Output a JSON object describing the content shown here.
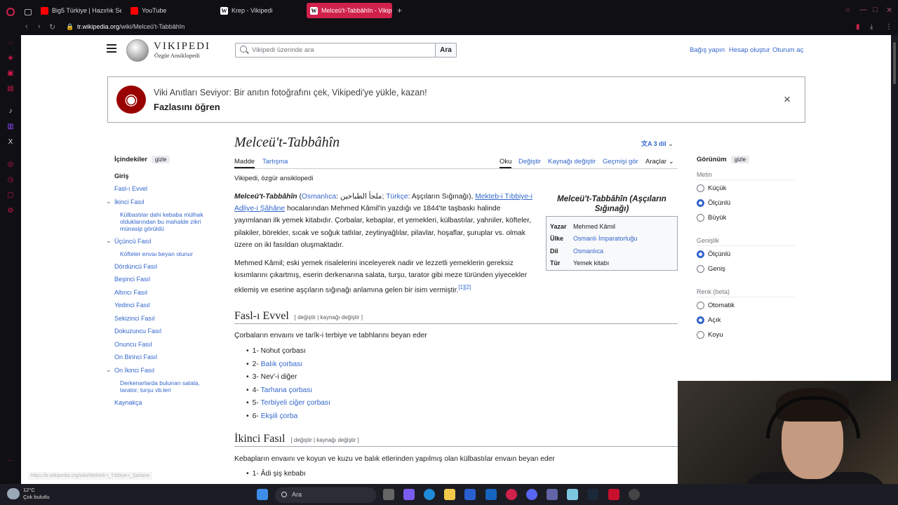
{
  "browser": {
    "tabs": [
      {
        "label": "Big5 Türkiye | Hazırlık Se",
        "icon": "youtube",
        "active": false
      },
      {
        "label": "YouTube",
        "icon": "youtube",
        "active": false
      },
      {
        "label": "Krep - Vikipedi",
        "icon": "wikipedia",
        "active": false
      },
      {
        "label": "Melceü't-Tabbâhîn - Vikip",
        "icon": "wikipedia",
        "active": true
      }
    ],
    "new_tab": "+",
    "url_host": "tr.wikipedia.org",
    "url_path": "/wiki/Melceü't-Tabbâhîn",
    "status_url": "https://tr.wikipedia.org/wiki/Mekteb-i_Tıbbiye-i_Şahane",
    "accent": "#d0214b"
  },
  "site": {
    "name": "Vikipedi",
    "tagline": "Özgür Ansiklopedi",
    "search_placeholder": "Vikipedi üzerinde ara",
    "search_button": "Ara",
    "top_links": [
      "Bağış yapın",
      "Hesap oluştur",
      "Oturum aç"
    ]
  },
  "notice": {
    "text": "Viki Anıtları Seviyor: Bir anıtın fotoğrafını çek, Vikipedi'ye yükle, kazan!",
    "more": "Fazlasını öğren",
    "close": "×"
  },
  "toc": {
    "heading": "İçindekiler",
    "hide": "gizle",
    "items": [
      {
        "label": "Giriş",
        "level": 0,
        "current": true,
        "expand": false
      },
      {
        "label": "Fasl-ı Evvel",
        "level": 0,
        "current": false,
        "expand": false
      },
      {
        "label": "İkinci Fasıl",
        "level": 0,
        "current": false,
        "expand": true
      },
      {
        "label": "Külbastılar dahi kebaba mülhak olduklarından bu mahalde zikri münasip görüldü",
        "level": 1,
        "current": false,
        "expand": false
      },
      {
        "label": "Üçüncü Fasıl",
        "level": 0,
        "current": false,
        "expand": true
      },
      {
        "label": "Köfteler envaı beyan olunur",
        "level": 1,
        "current": false,
        "expand": false
      },
      {
        "label": "Dördüncü Fasıl",
        "level": 0,
        "current": false,
        "expand": false
      },
      {
        "label": "Beşinci Fasıl",
        "level": 0,
        "current": false,
        "expand": false
      },
      {
        "label": "Altıncı Fasıl",
        "level": 0,
        "current": false,
        "expand": false
      },
      {
        "label": "Yedinci Fasıl",
        "level": 0,
        "current": false,
        "expand": false
      },
      {
        "label": "Sekizinci Fasıl",
        "level": 0,
        "current": false,
        "expand": false
      },
      {
        "label": "Dokuzuncu Fasıl",
        "level": 0,
        "current": false,
        "expand": false
      },
      {
        "label": "Onuncu Fasıl",
        "level": 0,
        "current": false,
        "expand": false
      },
      {
        "label": "On Birinci Fasıl",
        "level": 0,
        "current": false,
        "expand": false
      },
      {
        "label": "On İkinci Fasıl",
        "level": 0,
        "current": false,
        "expand": true
      },
      {
        "label": "Derkenarlarda bulunan salata, tarator, turşu vb.leri",
        "level": 1,
        "current": false,
        "expand": false
      },
      {
        "label": "Kaynakça",
        "level": 0,
        "current": false,
        "expand": false
      }
    ]
  },
  "article": {
    "title": "Melceü't-Tabbâhîn",
    "languages": "3 dil",
    "tabs_left": [
      {
        "label": "Madde",
        "selected": true
      },
      {
        "label": "Tartışma",
        "selected": false
      }
    ],
    "tabs_right": [
      {
        "label": "Oku",
        "selected": true
      },
      {
        "label": "Değiştir",
        "selected": false
      },
      {
        "label": "Kaynağı değiştir",
        "selected": false
      },
      {
        "label": "Geçmişi gör",
        "selected": false
      },
      {
        "label": "Araçlar",
        "selected": false
      }
    ],
    "site_sub": "Vikipedi, özgür ansiklopedi",
    "p1": {
      "bold": "Melceü't-Tabbâhîn",
      "paren_open": " (",
      "lang1": "Osmanlıca",
      "ottoman": ": ملجأ الطباخين",
      "sep": "; ",
      "lang2": "Türkçe",
      "meaning": ": Aşçıların Sığınağı), ",
      "link": "Mekteb-i Tıbbiye-i Adliye-i Şâhâne",
      "rest": " hocalarından Mehmed Kâmil'in yazdığı ve 1844'te taşbaskı halinde yayımlanan ilk yemek kitabıdır. Çorbalar, kebaplar, et yemekleri, külbastılar, yahniler, köfteler, pilakiler, börekler, sıcak ve soğuk tatlılar, zeytinyağlılar, pilavlar, hoşaflar, şuruplar vs. olmak üzere on iki fasıldan oluşmaktadır."
    },
    "p2": {
      "text": "Mehmed Kâmil; eski yemek risalelerini inceleyerek nadir ve lezzetli yemeklerin gereksiz kısımlarını çıkartmış, eserin derkenarına salata, turşu, tarator gibi meze türünden yiyecekler eklemiş ve eserine aşçıların sığınağı anlamına gelen bir isim vermiştir.",
      "refs": "[1][2]"
    },
    "edit_links": "[ değiştir | kaynağı değiştir ]",
    "section1": {
      "heading": "Fasl-ı Evvel",
      "intro": "Çorbaların envaını ve tarîk-i terbiye ve tabhlarını beyan eder",
      "items": [
        {
          "num": "1- ",
          "label": "Nohut çorbası",
          "link": false
        },
        {
          "num": "2- ",
          "label": "Balık çorbası",
          "link": true
        },
        {
          "num": "3- ",
          "label": "Nev'-i diğer",
          "link": false
        },
        {
          "num": "4- ",
          "label": "Tarhana çorbası",
          "link": true
        },
        {
          "num": "5- ",
          "label": "Terbiyeli ciğer çorbası",
          "link": true
        },
        {
          "num": "6- ",
          "label": "Ekşili çorba",
          "link": true
        }
      ]
    },
    "section2": {
      "heading": "İkinci Fasıl",
      "intro": "Kebapların envaını ve koyun ve kuzu ve balık etlerinden yapılmış olan külbastılar envaın beyan eder",
      "items": [
        {
          "num": "1- ",
          "label": "Âdi şiş kebabı",
          "link": false
        }
      ]
    }
  },
  "infobox": {
    "title": "Melceü't-Tabbâhîn (Aşçıların Sığınağı)",
    "rows": [
      {
        "key": "Yazar",
        "value": "Mehmed Kâmil",
        "link": false
      },
      {
        "key": "Ülke",
        "value": "Osmanlı İmparatorluğu",
        "link": true
      },
      {
        "key": "Dil",
        "value": "Osmanlıca",
        "link": true
      },
      {
        "key": "Tür",
        "value": "Yemek kitabı",
        "link": false
      }
    ]
  },
  "appearance": {
    "heading": "Görünüm",
    "hide": "gizle",
    "groups": [
      {
        "label": "Metin",
        "options": [
          {
            "label": "Küçük",
            "on": false
          },
          {
            "label": "Ölçünlü",
            "on": true
          },
          {
            "label": "Büyük",
            "on": false
          }
        ]
      },
      {
        "label": "Genişlik",
        "options": [
          {
            "label": "Ölçünlü",
            "on": true
          },
          {
            "label": "Geniş",
            "on": false
          }
        ]
      },
      {
        "label": "Renk (beta)",
        "options": [
          {
            "label": "Otomatik",
            "on": false
          },
          {
            "label": "Açık",
            "on": true
          },
          {
            "label": "Koyu",
            "on": false
          }
        ]
      }
    ]
  },
  "taskbar": {
    "temp": "12°C",
    "weather": "Çok bulutlu",
    "search": "Ara"
  }
}
